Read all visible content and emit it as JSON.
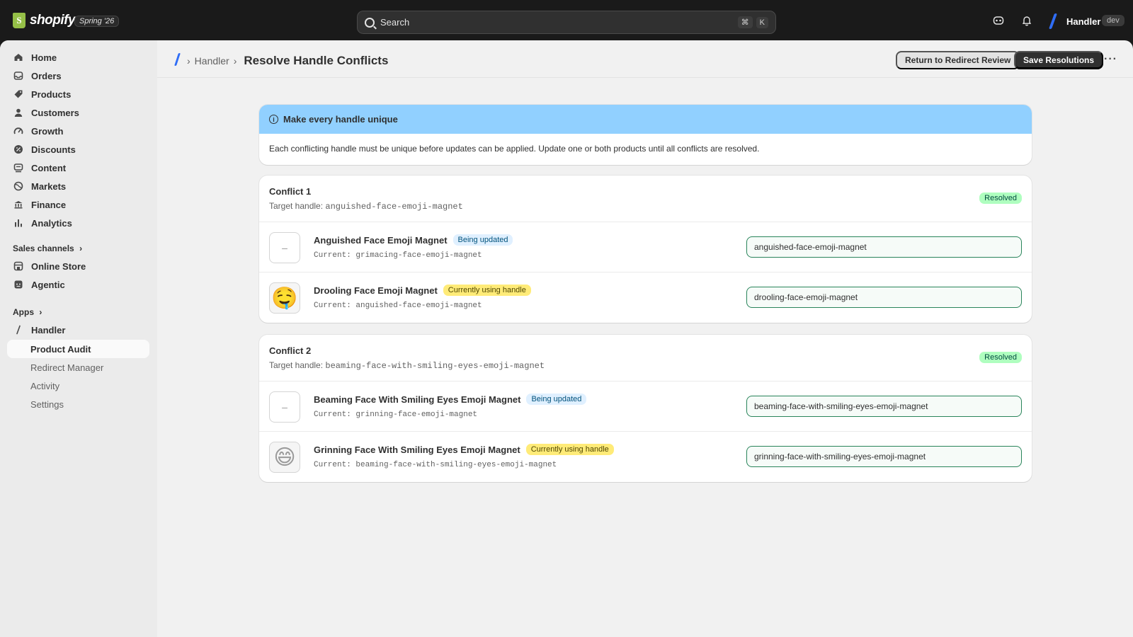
{
  "topbar": {
    "brand": "shopify",
    "edition": "Spring '26",
    "search_placeholder": "Search",
    "shortcut_keys": [
      "⌘",
      "K"
    ],
    "store_name": "Handler",
    "env_badge": "dev"
  },
  "sidebar": {
    "items": [
      {
        "label": "Home",
        "icon": "home-icon"
      },
      {
        "label": "Orders",
        "icon": "inbox-icon"
      },
      {
        "label": "Products",
        "icon": "tag-icon"
      },
      {
        "label": "Customers",
        "icon": "person-icon"
      },
      {
        "label": "Growth",
        "icon": "gauge-icon"
      },
      {
        "label": "Discounts",
        "icon": "discount-icon"
      },
      {
        "label": "Content",
        "icon": "content-icon"
      },
      {
        "label": "Markets",
        "icon": "globe-icon"
      },
      {
        "label": "Finance",
        "icon": "bank-icon"
      },
      {
        "label": "Analytics",
        "icon": "bar-chart-icon"
      }
    ],
    "sales_channels_label": "Sales channels",
    "channels": [
      {
        "label": "Online Store",
        "icon": "store-icon"
      },
      {
        "label": "Agentic",
        "icon": "agent-icon"
      }
    ],
    "apps_label": "Apps",
    "app_name": "Handler",
    "app_subitems": [
      "Product Audit",
      "Redirect Manager",
      "Activity",
      "Settings"
    ],
    "active_subitem": "Product Audit"
  },
  "header": {
    "breadcrumb_parent": "Handler",
    "title": "Resolve Handle Conflicts",
    "secondary_button": "Return to Redirect Review",
    "primary_button": "Save Resolutions",
    "more_label": "···"
  },
  "banner": {
    "title": "Make every handle unique",
    "body": "Each conflicting handle must be unique before updates can be applied. Update one or both products until all conflicts are resolved."
  },
  "conflicts": [
    {
      "title": "Conflict 1",
      "target_label": "Target handle:",
      "target_handle": "anguished-face-emoji-magnet",
      "status": "Resolved",
      "products": [
        {
          "name": "Anguished Face Emoji Magnet",
          "tag": "Being updated",
          "tag_color": "blue",
          "current": "Current: grimacing-face-emoji-magnet",
          "value": "anguished-face-emoji-magnet",
          "thumb": "–"
        },
        {
          "name": "Drooling Face Emoji Magnet",
          "tag": "Currently using handle",
          "tag_color": "yellow",
          "current": "Current: anguished-face-emoji-magnet",
          "value": "drooling-face-emoji-magnet",
          "thumb": "🤤"
        }
      ]
    },
    {
      "title": "Conflict 2",
      "target_label": "Target handle:",
      "target_handle": "beaming-face-with-smiling-eyes-emoji-magnet",
      "status": "Resolved",
      "products": [
        {
          "name": "Beaming Face With Smiling Eyes Emoji Magnet",
          "tag": "Being updated",
          "tag_color": "blue",
          "current": "Current: grinning-face-emoji-magnet",
          "value": "beaming-face-with-smiling-eyes-emoji-magnet",
          "thumb": "–"
        },
        {
          "name": "Grinning Face With Smiling Eyes Emoji Magnet",
          "tag": "Currently using handle",
          "tag_color": "yellow",
          "current": "Current: beaming-face-with-smiling-eyes-emoji-magnet",
          "value": "grinning-face-with-smiling-eyes-emoji-magnet",
          "thumb": "😄"
        }
      ]
    }
  ]
}
